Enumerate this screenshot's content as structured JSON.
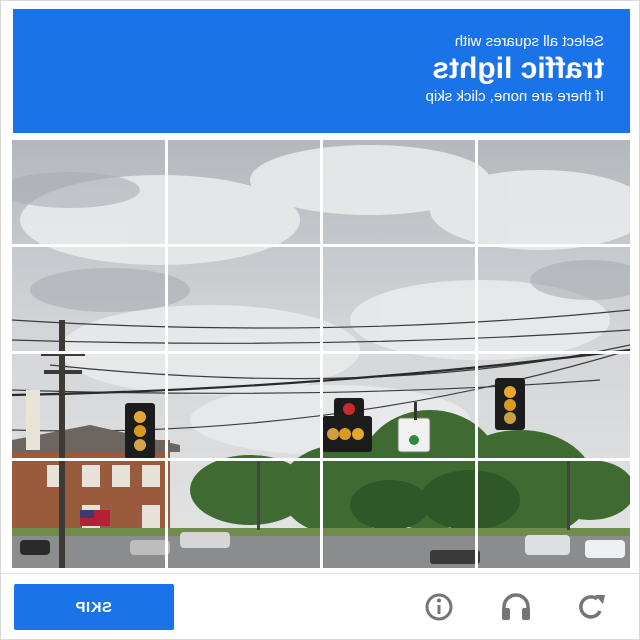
{
  "header": {
    "instruction": "Select all squares with",
    "target": "traffic lights",
    "hint": "If there are none, click skip"
  },
  "grid": {
    "rows": 4,
    "columns": 4,
    "image_content": "street scene with traffic lights, power lines, trees and buildings"
  },
  "footer": {
    "skip_label": "SKIP",
    "icons": [
      "reload-icon",
      "audio-headphones-icon",
      "info-icon"
    ]
  },
  "colors": {
    "accent": "#1a73e8",
    "icon_gray": "#757575"
  }
}
